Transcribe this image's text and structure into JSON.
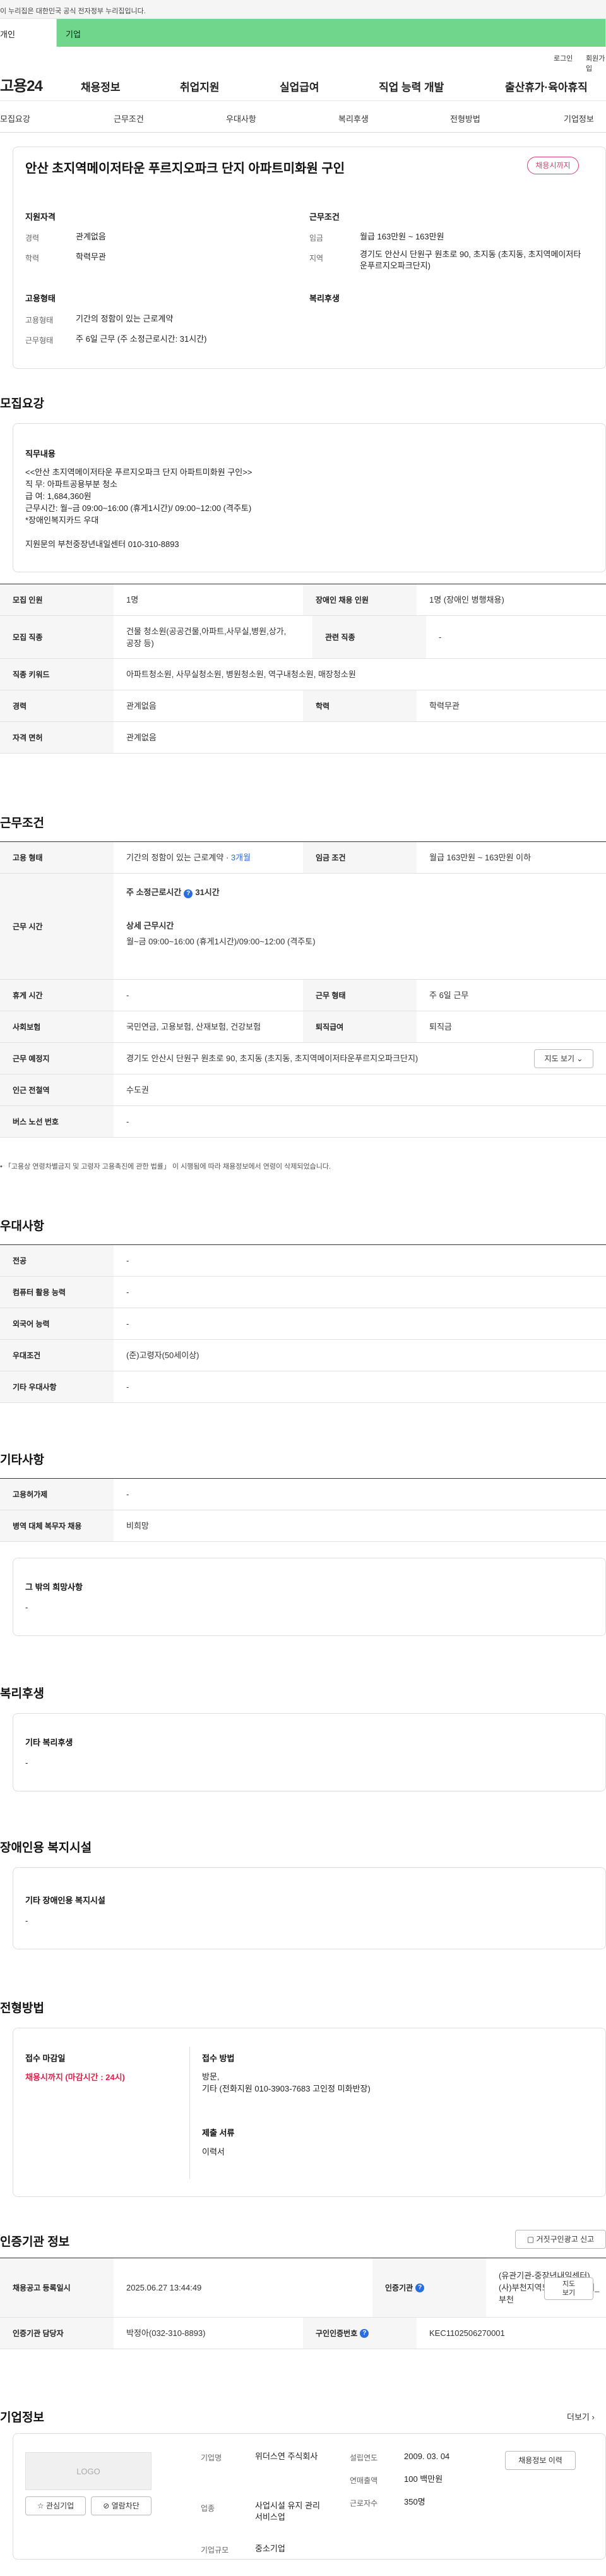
{
  "gov_bar": {
    "text": "이 누리집은 대한민국 공식 전자정부 누리집입니다."
  },
  "user_tabs": {
    "individual": "개인",
    "business": "기업"
  },
  "util": {
    "login": "로그인",
    "signup": "회원가입"
  },
  "gnb": {
    "logo": "고용24",
    "menus": [
      "채용정보",
      "취업지원",
      "실업급여",
      "직업 능력 개발",
      "출산휴가·육아휴직"
    ]
  },
  "lnb": [
    "모집요강",
    "근무조건",
    "우대사항",
    "복리후생",
    "전형방법",
    "기업정보"
  ],
  "summary": {
    "title": "안산 초지역메이저타운 푸르지오파크 단지 아파트미화원 구인",
    "badge": "채용시까지",
    "qualification": {
      "heading": "지원자격",
      "career_label": "경력",
      "career": "관계없음",
      "education_label": "학력",
      "education": "학력무관"
    },
    "conditions": {
      "heading": "근무조건",
      "wage_label": "임금",
      "wage": "월급 163만원 ~ 163만원",
      "location_label": "지역",
      "location": "경기도 안산시 단원구 원초로 90, 초지동 (초지동, 초지역메이저타운푸르지오파크단지)"
    },
    "employment": {
      "heading": "고용형태",
      "type_label": "고용형태",
      "type": "기간의 정함이 있는 근로계약",
      "worktype_label": "근무형태",
      "worktype": "주 6일 근무 (주 소정근로시간: 31시간)"
    },
    "welfare": {
      "heading": "복리후생"
    }
  },
  "recruit": {
    "title": "모집요강",
    "duty_heading": "직무내용",
    "duty_text": "<<안산 초지역메이저타운 푸르지오파크 단지 아파트미화원 구인>>\n직      무: 아파트공용부분 청소\n급      여: 1,684,360원\n근무시간: 월~금 09:00~16:00 (휴게1시간)/ 09:00~12:00 (격주토)\n*장애인복지카드 우대",
    "contact": "지원문의 부천중장년내일센터  010-310-8893",
    "rows": {
      "headcount_label": "모집 인원",
      "headcount": "1명",
      "disabled_label": "장애인 채용 인원",
      "disabled": "1명 (장애인 병행채용)",
      "job_label": "모집 직종",
      "job": "건물 청소원(공공건물,아파트,사무실,병원,상가,공장 등)",
      "related_label": "관련 직종",
      "related": "-",
      "keyword_label": "직종 키워드",
      "keyword": "아파트청소원, 사무실청소원, 병원청소원, 역구내청소원, 매장청소원",
      "career_label": "경력",
      "career": "관계없음",
      "education_label": "학력",
      "education": "학력무관",
      "license_label": "자격 면허",
      "license": "관계없음"
    }
  },
  "work": {
    "title": "근무조건",
    "type_label": "고용 형태",
    "type_prefix": "기간의 정함이 있는 근로계약 · ",
    "type_months": "3개월",
    "wage_label": "임금 조건",
    "wage": "월급 163만원 ~ 163만원 이하",
    "hours_label": "근무 시간",
    "hours_weekly_label": "주 소정근로시간",
    "hours_weekly": "31시간",
    "hours_detail_label": "상세 근무시간",
    "hours_detail": "월~금 09:00~16:00 (휴게1시간)/09:00~12:00 (격주토)",
    "break_label": "휴게 시간",
    "break": "-",
    "form_label": "근무 형태",
    "form": "주 6일 근무",
    "insurance_label": "사회보험",
    "insurance": "국민연금, 고용보험, 산재보험, 건강보험",
    "severance_label": "퇴직급여",
    "severance": "퇴직금",
    "place_label": "근무 예정지",
    "place": "경기도 안산시 단원구 원초로 90, 초지동 (초지동, 초지역메이저타운푸르지오파크단지)",
    "map_btn": "지도 보기",
    "subway_label": "인근 전철역",
    "subway": "수도권",
    "bus_label": "버스 노선 번호",
    "bus": "-",
    "note": "「고용상 연령차별금지 및 고령자 고용촉진에 관한 법률」 이 시행됨에 따라 채용정보에서 연령이 삭제되었습니다."
  },
  "preference": {
    "title": "우대사항",
    "major_label": "전공",
    "major": "-",
    "computer_label": "컴퓨터 활용 능력",
    "computer": "-",
    "language_label": "외국어 능력",
    "language": "-",
    "cond_label": "우대조건",
    "cond": "(준)고령자(50세이상)",
    "etc_label": "기타 우대사항",
    "etc": "-"
  },
  "other": {
    "title": "기타사항",
    "hire_label": "고용허가제",
    "hire": "-",
    "military_label": "병역 대체 복무자 채용",
    "military": "비희망",
    "extra_heading": "그 밖의 희망사항",
    "extra": "-"
  },
  "benefits": {
    "title": "복리후생",
    "heading": "기타 복리후생",
    "value": "-"
  },
  "disabled_fac": {
    "title": "장애인용 복지시설",
    "heading": "기타 장애인용 복지시설",
    "value": "-"
  },
  "selection": {
    "title": "전형방법",
    "deadline_heading": "접수 마감일",
    "deadline": "채용시까지 (마감시간 : 24시)",
    "method_heading": "접수 방법",
    "method": "방문,\n기타 (전화지원 010-3903-7683 고인정 미화반장)",
    "docs_heading": "제출 서류",
    "docs": "이력서"
  },
  "agency": {
    "title": "인증기관 정보",
    "report_btn": "거짓구인광고 신고",
    "posted_label": "채용공고 등록일시",
    "posted": "2025.06.27 13:44:49",
    "org_label": "인증기관",
    "org": "(유관기관-중장년내일센터)\n(사)부천지역노사발전협의회_부천",
    "map_btn": "지도\n보기",
    "manager_label": "인증기관 담당자",
    "manager": "박정아(032-310-8893)",
    "number_label": "구인인증번호",
    "number": "KEC1102506270001"
  },
  "company": {
    "title": "기업정보",
    "more": "더보기",
    "logo": "LOGO",
    "fav_btn": "관심기업",
    "block_btn": "열람차단",
    "name_label": "기업명",
    "name": "위더스연 주식회사",
    "founded_label": "설립연도",
    "founded": "2009. 03. 04",
    "sales_label": "연매출액",
    "sales": "100 백만원",
    "industry_label": "업종",
    "industry": "사업시설 유지 관리 서비스업",
    "employees_label": "근로자수",
    "employees": "350명",
    "size_label": "기업규모",
    "size": "중소기업",
    "jobs_btn": "채용정보 이력"
  },
  "colors": {
    "accent_green": "#6fd68c",
    "badge_red": "#e04070",
    "highlight_red": "#e0204a",
    "link_blue": "#2b6de0"
  }
}
